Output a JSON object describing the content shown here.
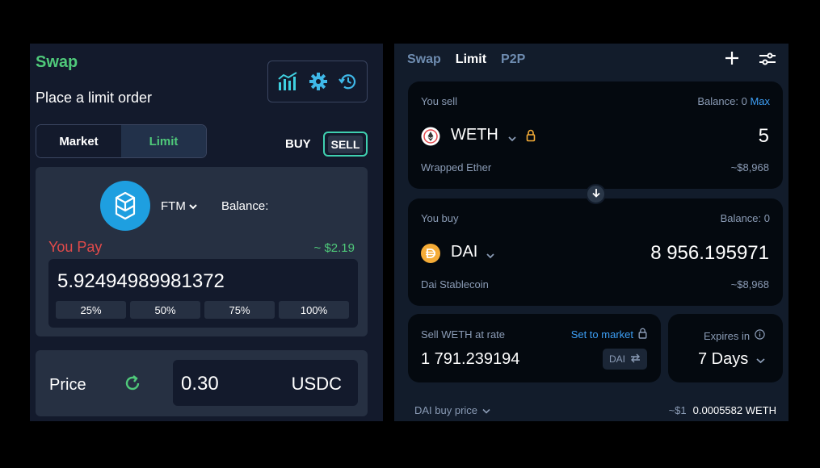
{
  "left": {
    "title": "Swap",
    "subtitle": "Place a limit order",
    "icons": [
      "chart-icon",
      "gear-icon",
      "history-icon"
    ],
    "mode_tabs": [
      "Market",
      "Limit"
    ],
    "active_mode": "Limit",
    "buy_label": "BUY",
    "sell_label": "SELL",
    "token": {
      "symbol": "FTM",
      "icon": "fantom-logo"
    },
    "balance_label": "Balance:",
    "you_pay_label": "You Pay",
    "pay_usd": "~ $2.19",
    "pay_amount": "5.92494989981372",
    "percent_buttons": [
      "25%",
      "50%",
      "75%",
      "100%"
    ],
    "price_label": "Price",
    "price_value": "0.30",
    "price_currency": "USDC"
  },
  "right": {
    "tabs": [
      "Swap",
      "Limit",
      "P2P"
    ],
    "active_tab": "Limit",
    "sell": {
      "label": "You sell",
      "balance": "Balance: 0",
      "max": "Max",
      "token": "WETH",
      "amount": "5",
      "token_full": "Wrapped Ether",
      "usd": "~$8,968"
    },
    "buy": {
      "label": "You buy",
      "balance": "Balance: 0",
      "token": "DAI",
      "amount": "8 956.195971",
      "token_full": "Dai Stablecoin",
      "usd": "~$8,968"
    },
    "rate": {
      "label": "Sell WETH at rate",
      "set_market": "Set to market",
      "value": "1 791.239194",
      "unit": "DAI"
    },
    "expires": {
      "label": "Expires in",
      "value": "7 Days"
    },
    "footer": {
      "left": "DAI buy price",
      "usd": "~$1",
      "value": "0.0005582 WETH"
    }
  },
  "colors": {
    "accent_green": "#4fc97a",
    "link_blue": "#3d9ff5",
    "you_pay_red": "#e04a4a",
    "ftm_blue": "#1e9fe0",
    "dai_orange": "#f5ac37"
  }
}
